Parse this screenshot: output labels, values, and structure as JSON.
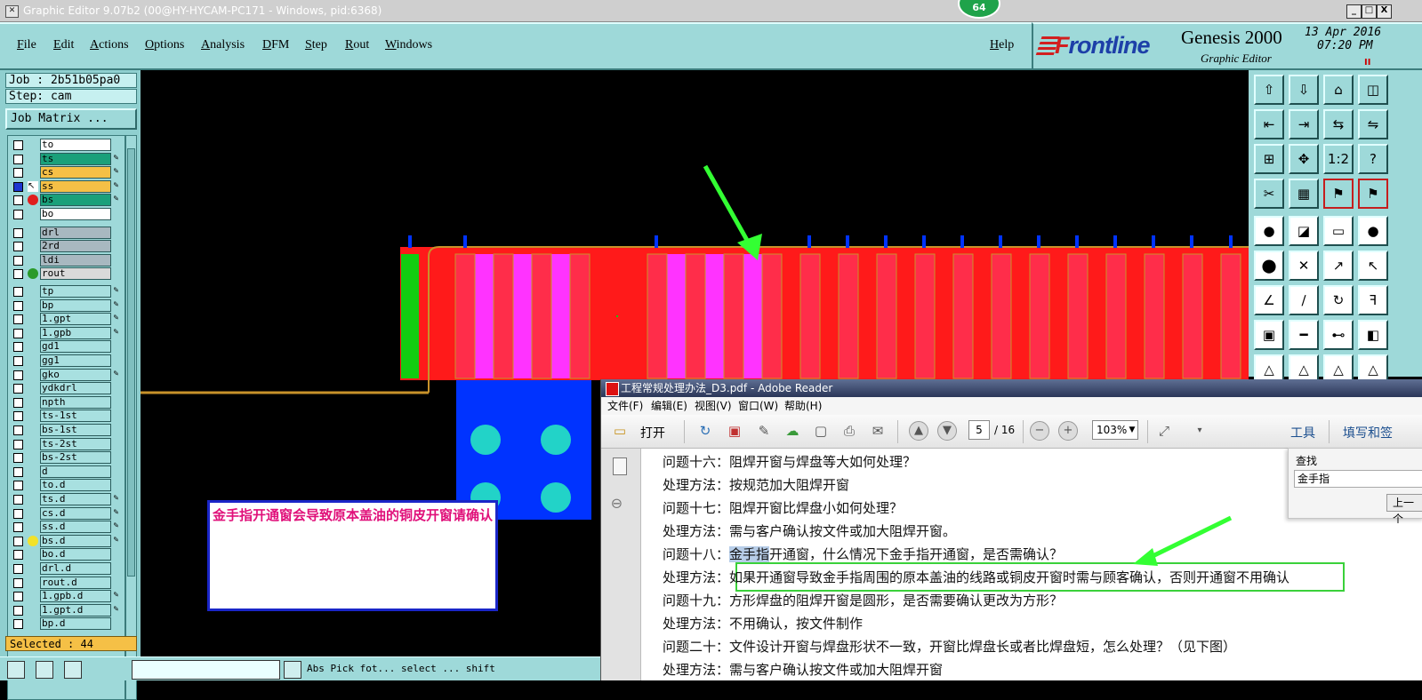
{
  "window": {
    "title": "Graphic Editor 9.07b2 (00@HY-HYCAM-PC171 - Windows, pid:6368)",
    "badge": "64",
    "controls": [
      "_",
      "□",
      "X"
    ]
  },
  "menu": {
    "items": [
      "File",
      "Edit",
      "Actions",
      "Options",
      "Analysis",
      "DFM",
      "Step",
      "Rout",
      "Windows"
    ],
    "help": "Help"
  },
  "brand": {
    "logo_a": "F",
    "logo_b": "rontline",
    "product": "Genesis 2000",
    "subtitle": "Graphic Editor",
    "date": "13 Apr 2016",
    "time": "07:20 PM",
    "pause_icon": "II"
  },
  "left_panel": {
    "job": "Job : 2b51b05pa0",
    "step": "Step: cam",
    "job_matrix": "Job Matrix ...",
    "selected": "Selected : 44",
    "layers": [
      {
        "name": "to",
        "color": "#ffffff",
        "mark": ""
      },
      {
        "name": "ts",
        "color": "#1aa07a",
        "mark": "✎"
      },
      {
        "name": "cs",
        "color": "#f5c046",
        "mark": "✎"
      },
      {
        "name": "ss",
        "color": "#f5c046",
        "mark": "✎"
      },
      {
        "name": "bs",
        "color": "#1aa07a",
        "mark": "✎"
      },
      {
        "name": "bo",
        "color": "#ffffff",
        "mark": ""
      },
      {
        "name": "drl",
        "color": "#a8b8c0",
        "mark": ""
      },
      {
        "name": "2rd",
        "color": "#a8b8c0",
        "mark": ""
      },
      {
        "name": "ldi",
        "color": "#a8b8c0",
        "mark": ""
      },
      {
        "name": "rout",
        "color": "#d9d9d9",
        "mark": ""
      },
      {
        "name": "tp",
        "color": "#a8e0e0",
        "mark": "✎"
      },
      {
        "name": "bp",
        "color": "#a8e0e0",
        "mark": "✎"
      },
      {
        "name": "1.gpt",
        "color": "#a8e0e0",
        "mark": "✎"
      },
      {
        "name": "1.gpb",
        "color": "#a8e0e0",
        "mark": "✎"
      },
      {
        "name": "gd1",
        "color": "#a8e0e0",
        "mark": ""
      },
      {
        "name": "gg1",
        "color": "#a8e0e0",
        "mark": ""
      },
      {
        "name": "gko",
        "color": "#a8e0e0",
        "mark": "✎"
      },
      {
        "name": "ydkdrl",
        "color": "#a8e0e0",
        "mark": ""
      },
      {
        "name": "npth",
        "color": "#a8e0e0",
        "mark": ""
      },
      {
        "name": "ts-1st",
        "color": "#a8e0e0",
        "mark": ""
      },
      {
        "name": "bs-1st",
        "color": "#a8e0e0",
        "mark": ""
      },
      {
        "name": "ts-2st",
        "color": "#a8e0e0",
        "mark": ""
      },
      {
        "name": "bs-2st",
        "color": "#a8e0e0",
        "mark": ""
      },
      {
        "name": "d",
        "color": "#a8e0e0",
        "mark": ""
      },
      {
        "name": "to.d",
        "color": "#a8e0e0",
        "mark": ""
      },
      {
        "name": "ts.d",
        "color": "#a8e0e0",
        "mark": "✎"
      },
      {
        "name": "cs.d",
        "color": "#a8e0e0",
        "mark": "✎"
      },
      {
        "name": "ss.d",
        "color": "#a8e0e0",
        "mark": "✎"
      },
      {
        "name": "bs.d",
        "color": "#a8e0e0",
        "mark": "✎"
      },
      {
        "name": "bo.d",
        "color": "#a8e0e0",
        "mark": ""
      },
      {
        "name": "drl.d",
        "color": "#a8e0e0",
        "mark": ""
      },
      {
        "name": "rout.d",
        "color": "#a8e0e0",
        "mark": ""
      },
      {
        "name": "1.gpb.d",
        "color": "#a8e0e0",
        "mark": "✎"
      },
      {
        "name": "1.gpt.d",
        "color": "#a8e0e0",
        "mark": "✎"
      },
      {
        "name": "bp.d",
        "color": "#a8e0e0",
        "mark": ""
      }
    ]
  },
  "canvas": {
    "callout_text": "金手指开通窗会导致原本盖油的铜皮开窗请确认",
    "colors": {
      "copper": "#ff1a1a",
      "finger": "#ff2d4a",
      "mask": "#ff33ff",
      "green": "#11cc11",
      "blue": "#0033ff",
      "pad": "#22d3c8",
      "rout": "#c8922a"
    }
  },
  "status_bar": {
    "text": "Abs Pick fot... select ... shift"
  },
  "reader": {
    "title": "工程常规处理办法_D3.pdf - Adobe Reader",
    "menu": [
      "文件(F)",
      "编辑(E)",
      "视图(V)",
      "窗口(W)",
      "帮助(H)"
    ],
    "open_label": "打开",
    "page": "5",
    "pages_total": "/ 16",
    "zoom": "103%",
    "tools_label": "工具",
    "fill_sign_label": "填写和签",
    "find": {
      "label": "查找",
      "value": "金手指",
      "prev_button": "上一个"
    },
    "lines": [
      {
        "prefix": "问题十六：",
        "text": "阻焊开窗与焊盘等大如何处理？"
      },
      {
        "prefix": "处理方法：",
        "text": "按规范加大阻焊开窗"
      },
      {
        "prefix": "问题十七：",
        "text": "阻焊开窗比焊盘小如何处理？"
      },
      {
        "prefix": "处理方法：",
        "text": "需与客户确认按文件或加大阻焊开窗。"
      },
      {
        "prefix": "问题十八：",
        "highlight": "金手指",
        "text": "开通窗，什么情况下金手指开通窗，是否需确认？"
      },
      {
        "prefix": "处理方法：",
        "text": "如果开通窗导致金手指周围的原本盖油的线路或铜皮开窗时需与顾客确认，否则开通窗不用确认"
      },
      {
        "prefix": "问题十九：",
        "text": "方形焊盘的阻焊开窗是圆形，是否需要确认更改为方形？"
      },
      {
        "prefix": "处理方法：",
        "text": "不用确认，按文件制作"
      },
      {
        "prefix": "问题二十：",
        "text": "文件设计开窗与焊盘形状不一致，开窗比焊盘长或者比焊盘短，怎么处理？（见下图）"
      },
      {
        "prefix": "处理方法：",
        "text": "需与客户确认按文件或加大阻焊开窗"
      }
    ]
  }
}
